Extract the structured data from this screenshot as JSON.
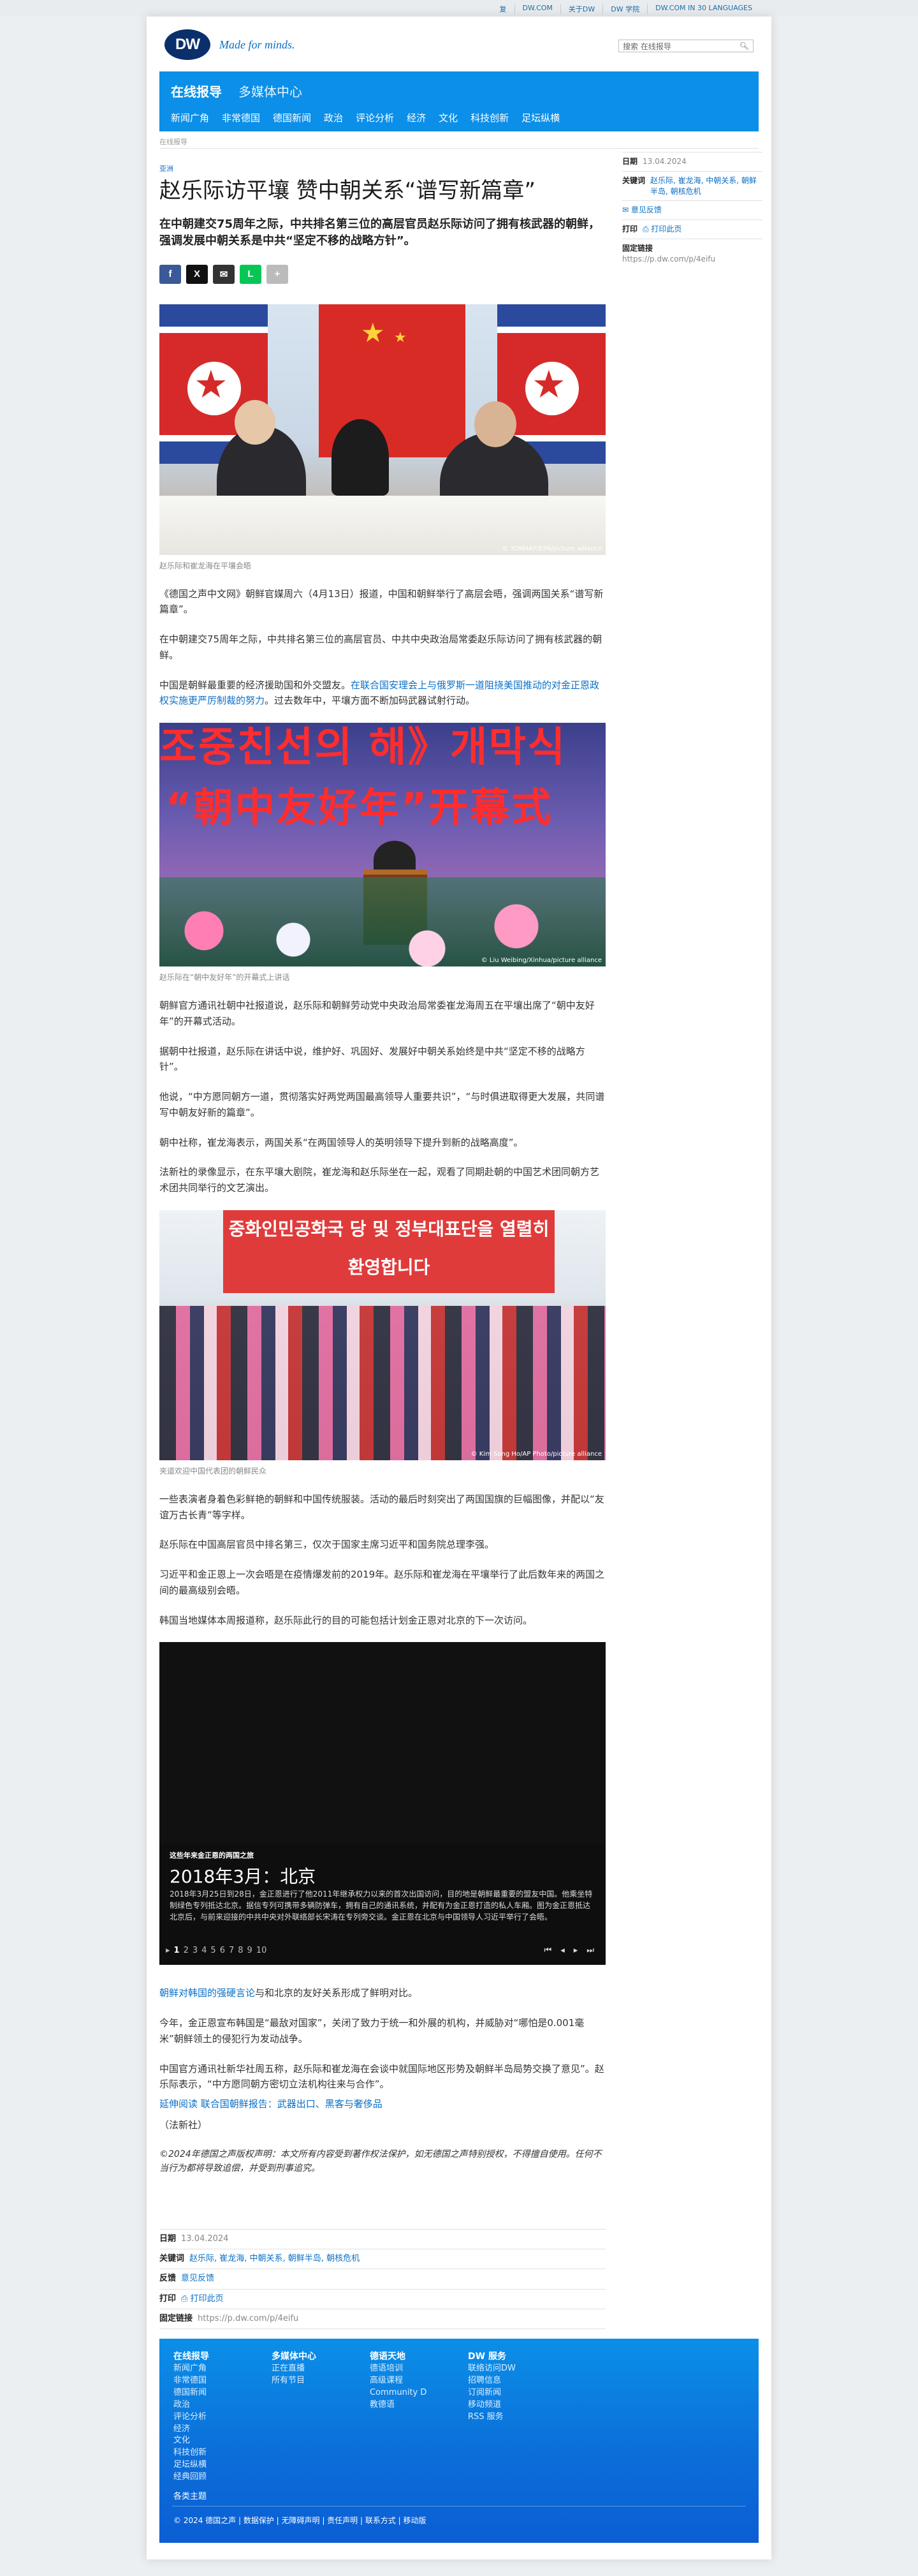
{
  "topbar": {
    "links": [
      "复",
      "DW.COM",
      "关于DW",
      "DW 学院",
      "DW.COM IN 30 LANGUAGES"
    ]
  },
  "header": {
    "logo": "DW",
    "tagline": "Made for minds.",
    "search_placeholder": "搜索 在线报导"
  },
  "nav": {
    "title": "在线报导",
    "subtitle": "多媒体中心",
    "items": [
      "新闻广角",
      "非常德国",
      "德国新闻",
      "政治",
      "评论分析",
      "经济",
      "文化",
      "科技创新",
      "足坛纵横"
    ]
  },
  "breadcrumb": "在线报导",
  "article": {
    "category": "亚洲",
    "headline": "赵乐际访平壤 赞中朝关系“谱写新篇章”",
    "lead": "在中朝建交75周年之际，中共排名第三位的高层官员赵乐际访问了拥有核武器的朝鲜，强调发展中朝关系是中共“坚定不移的战略方针”。",
    "share_icons": [
      "facebook-icon",
      "x-icon",
      "mail-icon",
      "line-icon",
      "more-icon"
    ],
    "image1": {
      "caption": "赵乐际和崔龙海在平壤会晤",
      "credit": "© YONHAP/EPA/picture alliance"
    },
    "p1": "《德国之声中文网》朝鲜官媒周六（4月13日）报道，中国和朝鲜举行了高层会晤，强调两国关系“谱写新篇章”。",
    "p2": "在中朝建交75周年之际，中共排名第三位的高层官员、中共中央政治局常委赵乐际访问了拥有核武器的朝鲜。",
    "p3_before": "中国是朝鲜最重要的经济援助国和外交盟友。",
    "p3_link": "在联合国安理会上与俄罗斯一道阻挠美国推动的对金正恩政权实施更严厉制裁的努力",
    "p3_after": "。过去数年中，平壤方面不断加码武器试射行动。",
    "image2": {
      "caption": "赵乐际在“朝中友好年”的开幕式上讲话",
      "credit": "© Liu Weibing/Xinhua/picture alliance",
      "banner_ko": "조중친선의 해》개막식",
      "banner_zh": "“朝中友好年”开幕式"
    },
    "p4": "朝鲜官方通讯社朝中社报道说，赵乐际和朝鲜劳动党中央政治局常委崔龙海周五在平壤出席了“朝中友好年”的开幕式活动。",
    "p5": "据朝中社报道，赵乐际在讲话中说，维护好、巩固好、发展好中朝关系始终是中共“坚定不移的战略方针”。",
    "p6": "他说，“中方愿同朝方一道，贯彻落实好两党两国最高领导人重要共识”，“与时俱进取得更大发展，共同谱写中朝友好新的篇章”。",
    "p7": "朝中社称，崔龙海表示，两国关系“在两国领导人的英明领导下提升到新的战略高度”。",
    "p8": "法新社的录像显示，在东平壤大剧院，崔龙海和赵乐际坐在一起，观看了同期赴朝的中国艺术团同朝方艺术团共同举行的文艺演出。",
    "image3": {
      "caption": "夹道欢迎中国代表团的朝鲜民众",
      "credit": "© Kim Song Ho/AP Photo/picture alliance",
      "banner": "중화인민공화국 당 및 정부대표단을 열렬히 환영합니다"
    },
    "p9": "一些表演者身着色彩鲜艳的朝鲜和中国传统服装。活动的最后时刻突出了两国国旗的巨幅图像，并配以“友谊万古长青”等字样。",
    "p10": "赵乐际在中国高层官员中排名第三，仅次于国家主席习近平和国务院总理李强。",
    "p11": "习近平和金正恩上一次会晤是在疫情爆发前的2019年。赵乐际和崔龙海在平壤举行了此后数年来的两国之间的最高级别会晤。",
    "p12": "韩国当地媒体本周报道称，赵乐际此行的目的可能包括计划金正恩对北京的下一次访问。",
    "gallery": {
      "label": "这些年来金正恩的两国之旅",
      "title": "2018年3月：北京",
      "text": "2018年3月25日到28日，金正恩进行了他2011年继承权力以来的首次出国访问，目的地是朝鲜最重要的盟友中国。他乘坐特制绿色专列抵达北京。据信专列可携带多辆防弹车，拥有自己的通讯系统，并配有为金正恩打造的私人车厢。图为金正恩抵达北京后，与前来迎接的中共中央对外联络部长宋涛在专列旁交谈。金正恩在北京与中国领导人习近平举行了会晤。",
      "pages": [
        "1",
        "2",
        "3",
        "4",
        "5",
        "6",
        "7",
        "8",
        "9",
        "10"
      ],
      "current": "1"
    },
    "p13_link": "朝鲜对韩国的强硬言论",
    "p13_after": "与和北京的友好关系形成了鲜明对比。",
    "p14": "今年，金正恩宣布韩国是“最敌对国家”，关闭了致力于统一和外展的机构，并威胁对“哪怕是0.001毫米”朝鲜领土的侵犯行为发动战争。",
    "p15": "中国官方通讯社新华社周五称，赵乐际和崔龙海在会谈中就国际地区形势及朝鲜半岛局势交换了意见”。赵乐际表示，“中方愿同朝方密切立法机构往来与合作”。",
    "p16": "延伸阅读 联合国朝鲜报告：武器出口、黑客与奢侈品",
    "source": "（法新社）",
    "copyright": "©2024年德国之声版权声明：本文所有内容受到著作权法保护，如无德国之声特别授权，不得擅自使用。任何不当行为都将导致追偿，并受到刑事追究。"
  },
  "meta": {
    "date_label": "日期",
    "date": "13.04.2024",
    "keywords_label": "关键词",
    "keywords": "赵乐际, 崔龙海, 中朝关系, 朝鲜半岛, 朝核危机",
    "feedback_label": "反馈",
    "feedback": "意见反馈",
    "feedback_side": "✉ 意见反馈",
    "print_label": "打印",
    "print": "⎙ 打印此页",
    "permalink_label": "固定链接",
    "permalink": "https://p.dw.com/p/4eifu"
  },
  "footer": {
    "col1": {
      "title": "在线报导",
      "items": [
        "新闻广角",
        "非常德国",
        "德国新闻",
        "政治",
        "评论分析",
        "经济",
        "文化",
        "科技创新",
        "足坛纵横",
        "经典回顾"
      ]
    },
    "col2": {
      "title": "多媒体中心",
      "items": [
        "正在直播",
        "所有节目"
      ]
    },
    "col3": {
      "title": "德语天地",
      "items": [
        "德语培训",
        "高级课程",
        "Community D",
        "教德语"
      ]
    },
    "col4": {
      "title": "DW 服务",
      "items": [
        "联络访问DW",
        "招聘信息",
        "订阅新闻",
        "移动频道",
        "RSS 服务"
      ]
    },
    "theme": "各类主题",
    "copy": "© 2024 德国之声 | 数据保护 | 无障碍声明 | 责任声明 | 联系方式 | 移动版"
  }
}
